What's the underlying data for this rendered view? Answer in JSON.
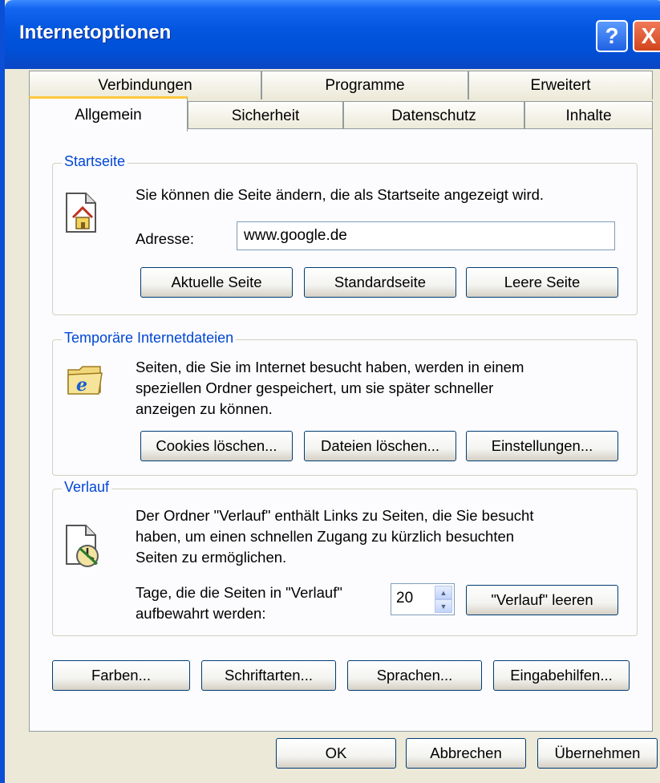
{
  "window": {
    "title": "Internetoptionen",
    "help_glyph": "?",
    "close_glyph": "X"
  },
  "tabs": {
    "row_back": [
      "Verbindungen",
      "Programme",
      "Erweitert"
    ],
    "row_front": [
      "Allgemein",
      "Sicherheit",
      "Datenschutz",
      "Inhalte"
    ],
    "active": "Allgemein"
  },
  "startseite": {
    "title": "Startseite",
    "description": "Sie können die Seite ändern, die als Startseite angezeigt wird.",
    "address_label": "Adresse:",
    "address_value": "www.google.de",
    "buttons": [
      "Aktuelle Seite",
      "Standardseite",
      "Leere Seite"
    ]
  },
  "temp": {
    "title": "Temporäre Internetdateien",
    "description_lines": [
      "Seiten, die Sie im Internet besucht haben, werden in einem",
      "speziellen Ordner gespeichert, um sie später schneller",
      "anzeigen zu können."
    ],
    "buttons": [
      "Cookies löschen...",
      "Dateien löschen...",
      "Einstellungen..."
    ]
  },
  "verlauf": {
    "title": "Verlauf",
    "description_lines": [
      "Der Ordner \"Verlauf\" enthält Links zu Seiten, die Sie besucht",
      "haben, um einen schnellen Zugang zu kürzlich besuchten",
      "Seiten zu ermöglichen."
    ],
    "days_label_lines": [
      "Tage, die die Seiten in \"Verlauf\"",
      "aufbewahrt werden:"
    ],
    "days_value": "20",
    "clear_button": "\"Verlauf\" leeren"
  },
  "bottom_buttons": [
    "Farben...",
    "Schriftarten...",
    "Sprachen...",
    "Eingabehilfen..."
  ],
  "dialog_buttons": {
    "ok": "OK",
    "cancel": "Abbrechen",
    "apply": "Übernehmen"
  },
  "colors": {
    "titlebar": "#0050d8",
    "group_title": "#0046d5",
    "dialog_bg": "#ece9d8",
    "tab_highlight": "#ffc83c"
  }
}
